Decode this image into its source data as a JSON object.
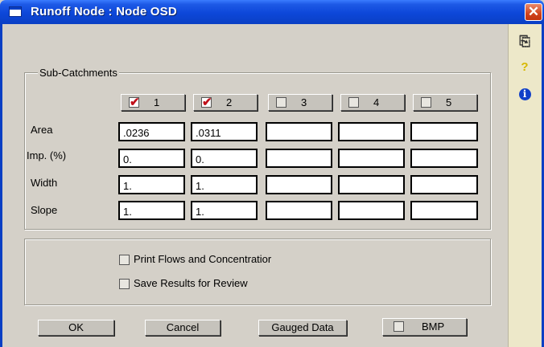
{
  "window": {
    "title": "Runoff Node : Node OSD",
    "close_symbol": "✕"
  },
  "sidebar": {
    "copy_symbol": "⎘",
    "help_symbol": "?",
    "info_symbol": "i"
  },
  "subcatchments": {
    "legend": "Sub-Catchments",
    "columns": [
      {
        "number": "1",
        "checked": true
      },
      {
        "number": "2",
        "checked": true
      },
      {
        "number": "3",
        "checked": false
      },
      {
        "number": "4",
        "checked": false
      },
      {
        "number": "5",
        "checked": false
      }
    ],
    "rows": [
      {
        "label": "Area",
        "values": [
          ".0236",
          ".0311",
          "",
          "",
          ""
        ]
      },
      {
        "label": "Imp. (%)",
        "values": [
          "0.",
          "0.",
          "",
          "",
          ""
        ]
      },
      {
        "label": "Width",
        "values": [
          "1.",
          "1.",
          "",
          "",
          ""
        ]
      },
      {
        "label": "Slope",
        "values": [
          "1.",
          "1.",
          "",
          "",
          ""
        ]
      }
    ]
  },
  "options": {
    "print_flows": {
      "label": "Print Flows and Concentratior",
      "checked": false
    },
    "save_results": {
      "label": "Save Results for Review",
      "checked": false
    }
  },
  "buttons": {
    "ok": "OK",
    "cancel": "Cancel",
    "gauged": "Gauged Data",
    "bmp": "BMP"
  }
}
